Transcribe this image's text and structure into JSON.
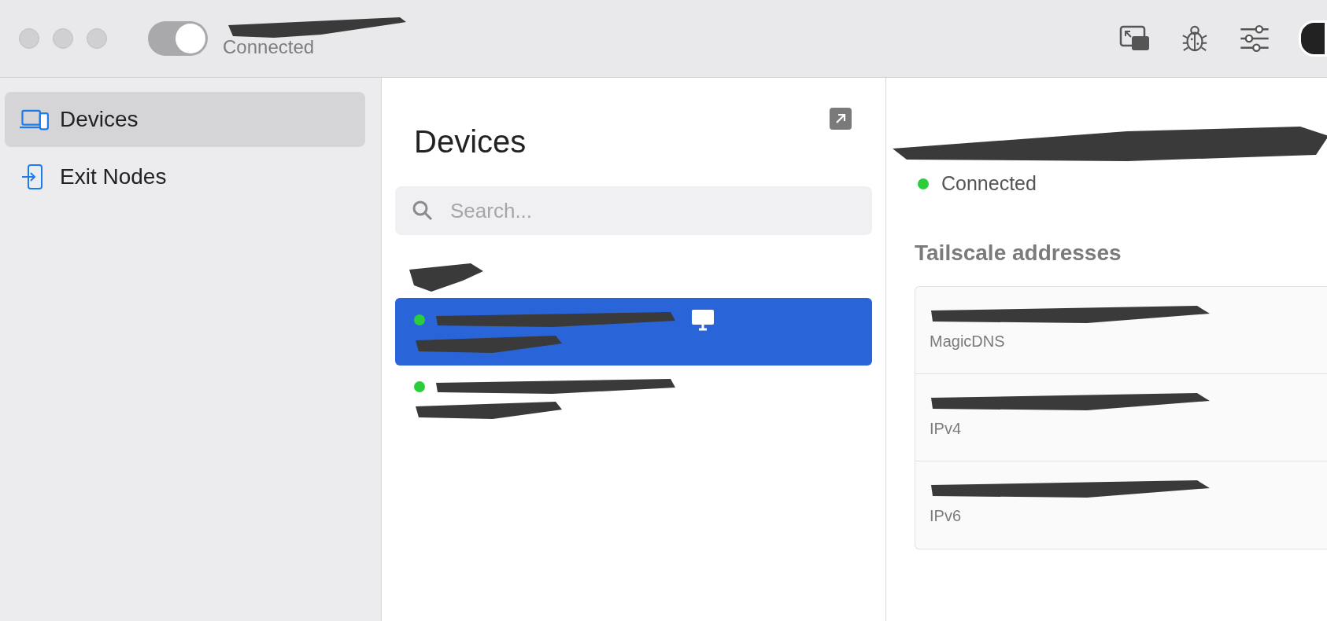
{
  "toolbar": {
    "vpn_toggle": {
      "on": true
    },
    "status": "Connected"
  },
  "sidebar": {
    "items": [
      {
        "label": "Devices",
        "selected": true,
        "kind": "devices"
      },
      {
        "label": "Exit Nodes",
        "selected": false,
        "kind": "exit"
      }
    ]
  },
  "devices_panel": {
    "title": "Devices",
    "search": {
      "placeholder": "Search..."
    },
    "devices": [
      {
        "selected": true,
        "online": true,
        "kind": "desktop"
      },
      {
        "selected": false,
        "online": true,
        "kind": "other"
      }
    ]
  },
  "detail": {
    "status": "Connected",
    "online": true,
    "section_title": "Tailscale addresses",
    "addresses": [
      {
        "label": "MagicDNS"
      },
      {
        "label": "IPv4"
      },
      {
        "label": "IPv6"
      }
    ]
  }
}
